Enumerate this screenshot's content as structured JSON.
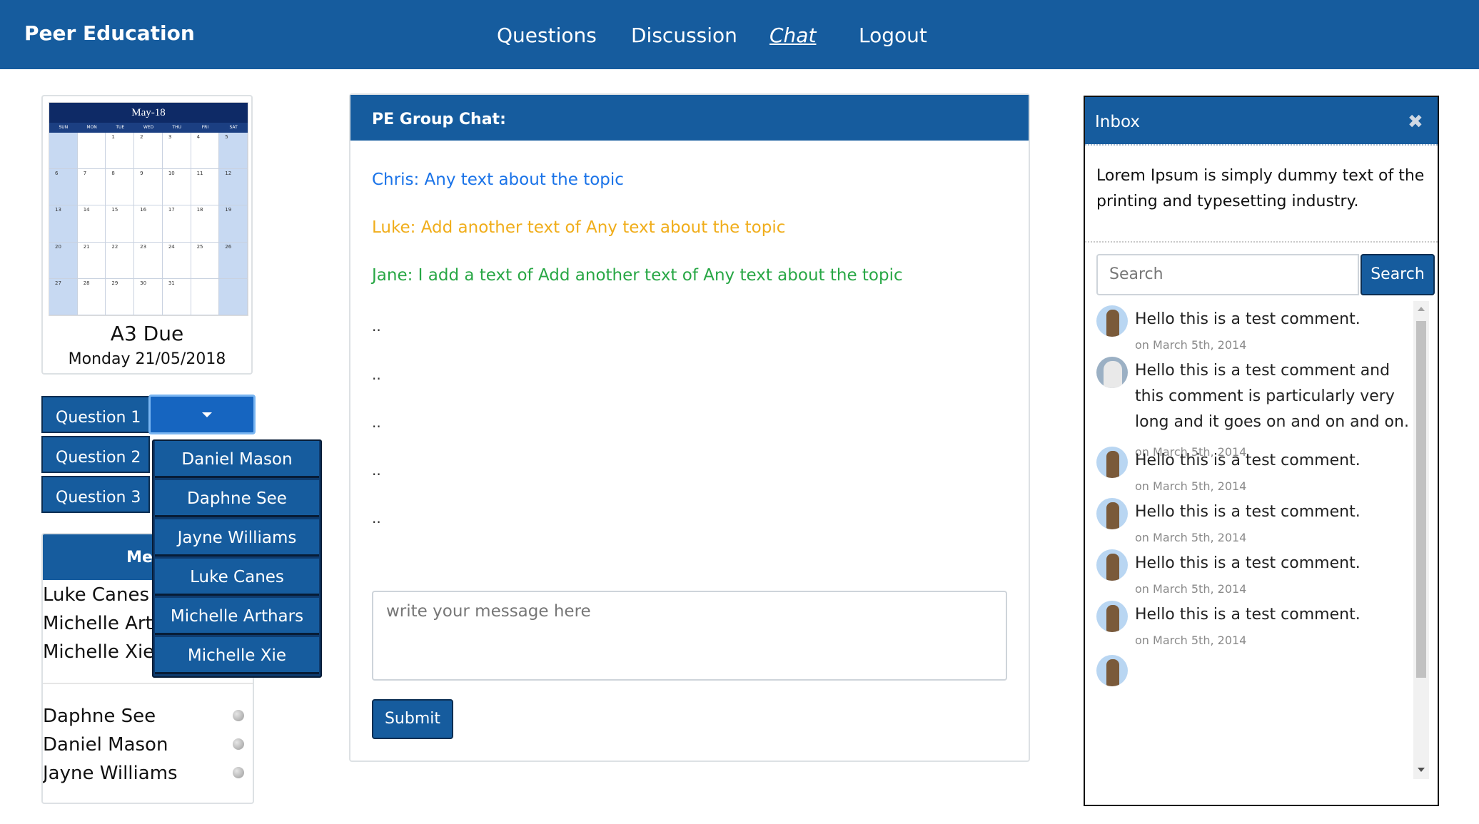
{
  "nav": {
    "brand": "Peer Education",
    "links": [
      "Questions",
      "Discussion",
      "Chat",
      "Logout"
    ],
    "active": "Chat"
  },
  "calendar": {
    "month": "May-18",
    "days": [
      "SUN",
      "MON",
      "TUE",
      "WED",
      "THU",
      "FRI",
      "SAT"
    ],
    "title": "A3 Due",
    "date": "Monday 21/05/2018"
  },
  "questions": {
    "items": [
      "Question 1",
      "Question 2",
      "Question 3"
    ],
    "dropdown": [
      "Daniel Mason",
      "Daphne See",
      "Jayne Williams",
      "Luke Canes",
      "Michelle Arthars",
      "Michelle Xie"
    ]
  },
  "members": {
    "header": "Mem",
    "group1": [
      "Luke Canes",
      "Michelle Arth",
      "Michelle Xie"
    ],
    "group2": [
      "Daphne See",
      "Daniel Mason",
      "Jayne Williams"
    ]
  },
  "chat": {
    "title": "PE Group Chat:",
    "messages": [
      {
        "text": "Chris: Any text about the topic",
        "color": "#1a73e8"
      },
      {
        "text": "Luke: Add another text of Any text about the topic",
        "color": "#f0ad1a"
      },
      {
        "text": "Jane: I add a text of Add another text of Any text about the topic",
        "color": "#28a745"
      }
    ],
    "placeholders": [
      "..",
      "..",
      "..",
      "..",
      ".."
    ],
    "input_placeholder": "write your message here",
    "submit": "Submit"
  },
  "inbox": {
    "title": "Inbox",
    "close": "✖",
    "text": "Lorem Ipsum is simply dummy text of the printing and typesetting industry.",
    "search_placeholder": "Search",
    "search_button": "Search",
    "comments": [
      {
        "text": "Hello this is a test comment.",
        "date": "on March 5th, 2014",
        "avatar": "cat-avatar-icon"
      },
      {
        "text": "Hello this is a test comment and this comment is particularly very long and it goes on and on and on.",
        "date": "on March 5th, 2014",
        "avatar": "white-cat-avatar-icon"
      },
      {
        "text": "Hello this is a test comment.",
        "date": "on March 5th, 2014",
        "avatar": "cat-avatar-icon"
      },
      {
        "text": "Hello this is a test comment.",
        "date": "on March 5th, 2014",
        "avatar": "cat-avatar-icon"
      },
      {
        "text": "Hello this is a test comment.",
        "date": "on March 5th, 2014",
        "avatar": "cat-avatar-icon"
      },
      {
        "text": "Hello this is a test comment.",
        "date": "on March 5th, 2014",
        "avatar": "cat-avatar-icon"
      }
    ]
  },
  "colors": {
    "primary": "#165c9e",
    "chris": "#1a73e8",
    "luke": "#f0ad1a",
    "jane": "#28a745"
  }
}
